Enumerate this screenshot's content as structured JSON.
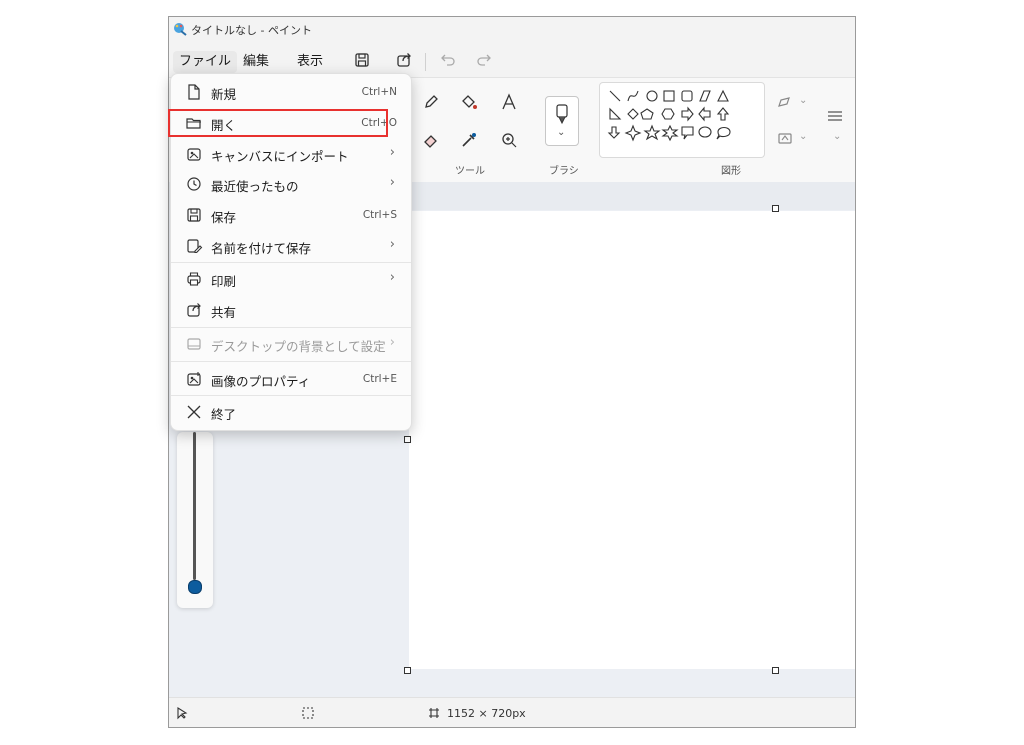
{
  "window": {
    "title": "タイトルなし - ペイント"
  },
  "menubar": {
    "file": "ファイル",
    "edit": "編集",
    "view": "表示"
  },
  "ribbon": {
    "tools_label": "ツール",
    "brush_label": "ブラシ",
    "shapes_label": "図形"
  },
  "file_menu": {
    "items": [
      {
        "label": "新規",
        "shortcut": "Ctrl+N",
        "icon": "new-file-icon"
      },
      {
        "label": "開く",
        "shortcut": "Ctrl+O",
        "icon": "open-folder-icon"
      },
      {
        "label": "キャンバスにインポート",
        "icon": "import-icon"
      },
      {
        "label": "最近使ったもの",
        "icon": "recent-clock-icon"
      },
      {
        "label": "保存",
        "shortcut": "Ctrl+S",
        "icon": "save-icon"
      },
      {
        "label": "名前を付けて保存",
        "icon": "save-as-icon"
      },
      {
        "label": "印刷",
        "icon": "print-icon"
      },
      {
        "label": "共有",
        "icon": "share-icon"
      },
      {
        "label": "デスクトップの背景として設定",
        "icon": "desktop-background-icon",
        "disabled": true
      },
      {
        "label": "画像のプロパティ",
        "shortcut": "Ctrl+E",
        "icon": "image-properties-icon"
      },
      {
        "label": "終了",
        "icon": "close-icon"
      }
    ],
    "chevron": "›"
  },
  "statusbar": {
    "canvas_size": "1152 × 720px"
  },
  "colors": {
    "highlight": "#e8312f",
    "accent": "#0d5c9e"
  }
}
